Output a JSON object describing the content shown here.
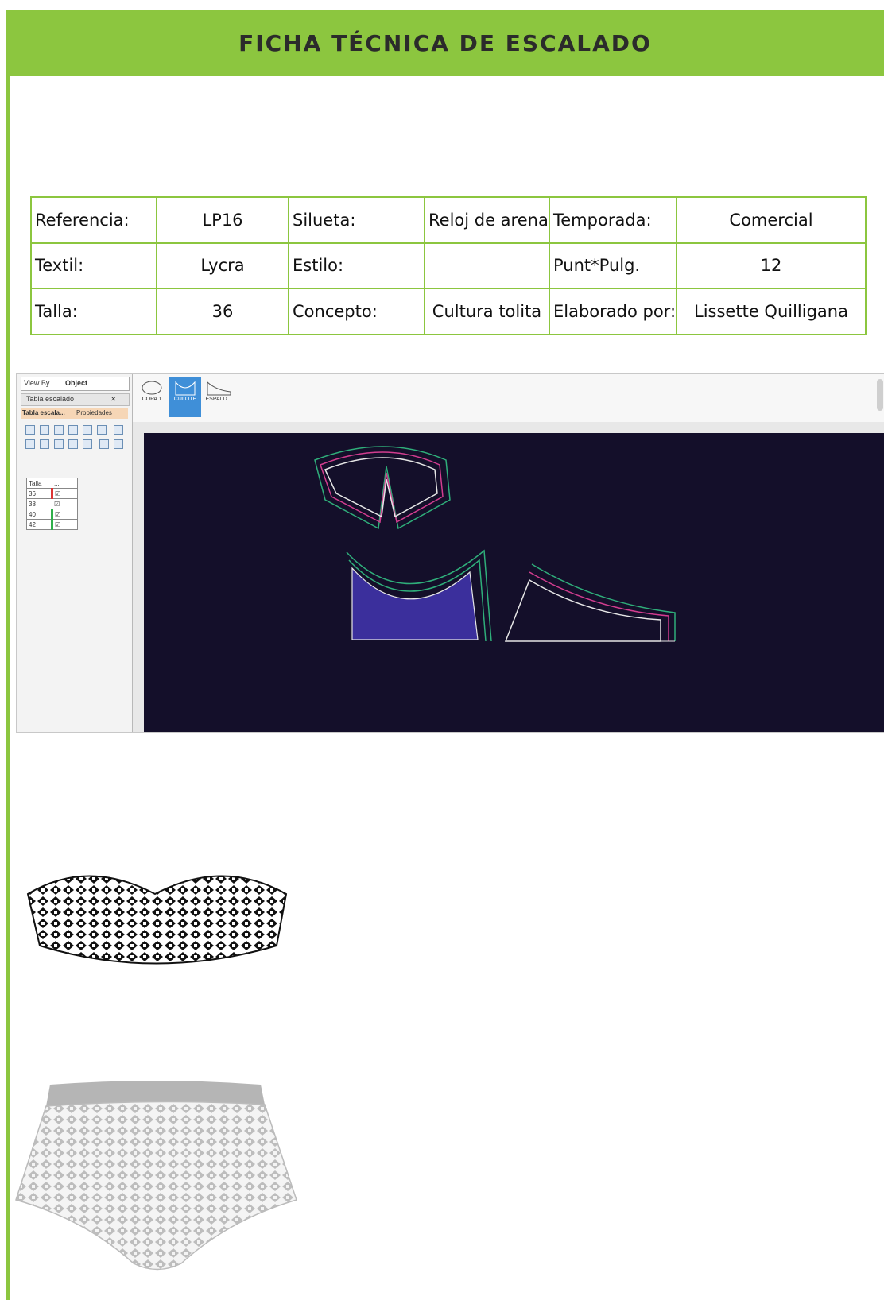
{
  "header": {
    "title": "FICHA TÉCNICA DE ESCALADO"
  },
  "spec": {
    "rows": [
      [
        {
          "label": "Referencia:",
          "value": "LP16"
        },
        {
          "label": "Silueta:",
          "value": "Reloj de arena"
        },
        {
          "label": "Temporada:",
          "value": "Comercial"
        }
      ],
      [
        {
          "label": "Textil:",
          "value": "Lycra"
        },
        {
          "label": "Estilo:",
          "value": ""
        },
        {
          "label": "Punt*Pulg.",
          "value": "12"
        }
      ],
      [
        {
          "label": "Talla:",
          "value": "36"
        },
        {
          "label": "Concepto:",
          "value": "Cultura tolita"
        },
        {
          "label": "Elaborado por:",
          "value": "Lissette Quilligana"
        }
      ]
    ]
  },
  "cad": {
    "view_by_label": "View By",
    "view_by_value": "Object",
    "panel_title": "Tabla escalado",
    "panel_tabs": [
      "Tabla escala...",
      "Propiedades"
    ],
    "size_table": {
      "header": [
        "Talla",
        "..."
      ],
      "rows": [
        "36",
        "38",
        "40",
        "42"
      ]
    },
    "thumbs": [
      {
        "label": "COPA 1",
        "selected": false
      },
      {
        "label": "CULOTE",
        "selected": true
      },
      {
        "label": "ESPALD...",
        "selected": false
      }
    ]
  },
  "colors": {
    "header_green": "#8cc63f",
    "canvas_bg": "#140f2a",
    "grade_green": "#2fae7a",
    "grade_magenta": "#d23d8f",
    "piece_fill": "#3b2f9c"
  }
}
